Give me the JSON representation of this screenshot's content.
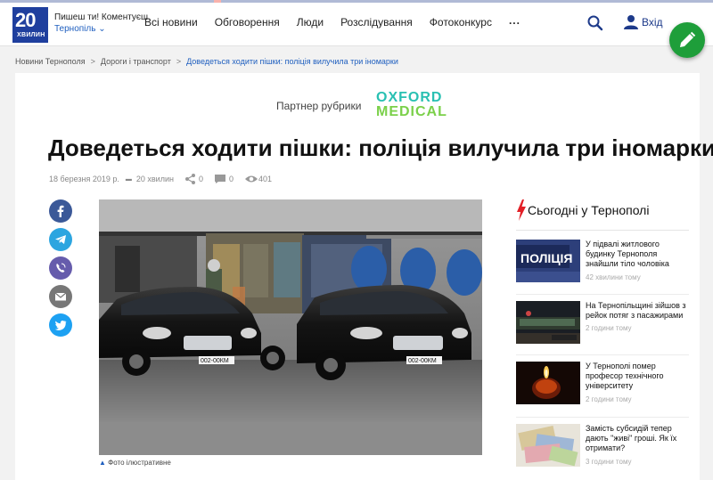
{
  "header": {
    "logo_number": "20",
    "logo_sub": "ХВИЛИН",
    "tagline": "Пишеш ти! Коментуєш",
    "city": "Тернопіль ⌄",
    "nav": [
      "Всі новини",
      "Обговорення",
      "Люди",
      "Розслідування",
      "Фотоконкурс",
      "..."
    ],
    "login": "Вхід",
    "icons": [
      "search-icon",
      "user-icon",
      "pencil-icon"
    ]
  },
  "breadcrumb": {
    "items": [
      "Новини Тернополя",
      "Дороги і транспорт"
    ],
    "separator": ">",
    "current": "Доведеться ходити пішки: поліція вилучила три іномарки"
  },
  "article": {
    "partner_label": "Партнер рубрики",
    "partner_logo_line1": "OXFORD",
    "partner_logo_line2": "MEDICAL",
    "title": "Доведеться ходити пішки: поліція вилучила три іномарки",
    "date": "18 березня 2019 р.",
    "author": "20 хвилин",
    "shares": "0",
    "comments": "0",
    "views": "401",
    "plate_left": "002-00КМ",
    "plate_right": "002-00КМ",
    "caption": "Фото ілюстративне",
    "share_buttons": [
      {
        "name": "facebook",
        "color": "#3b5998"
      },
      {
        "name": "telegram",
        "color": "#2ca5e0"
      },
      {
        "name": "viber",
        "color": "#665cac"
      },
      {
        "name": "email",
        "color": "#777777"
      },
      {
        "name": "twitter",
        "color": "#1da1f2"
      }
    ]
  },
  "sidebar": {
    "title": "Сьогодні у Тернополі",
    "items": [
      {
        "text": "У підвалі житлового будинку Тернополя знайшли тіло чоловіка",
        "time": "42 хвилини тому",
        "thumb_label": "ПОЛІЦІЯ"
      },
      {
        "text": "На Тернопільщині зійшов з рейок потяг з пасажирами",
        "time": "2 години тому",
        "thumb_label": ""
      },
      {
        "text": "У Тернополі помер професор технічного університету",
        "time": "2 години тому",
        "thumb_label": ""
      },
      {
        "text": "Замість субсидій тепер дають \"живі\" гроші. Як їх отримати?",
        "time": "3 години тому",
        "thumb_label": ""
      }
    ]
  },
  "colors": {
    "brand_blue": "#1f3f9e",
    "link_blue": "#1f5fbf",
    "fab_green": "#1e9e3a",
    "accent_red": "#e21f26"
  }
}
